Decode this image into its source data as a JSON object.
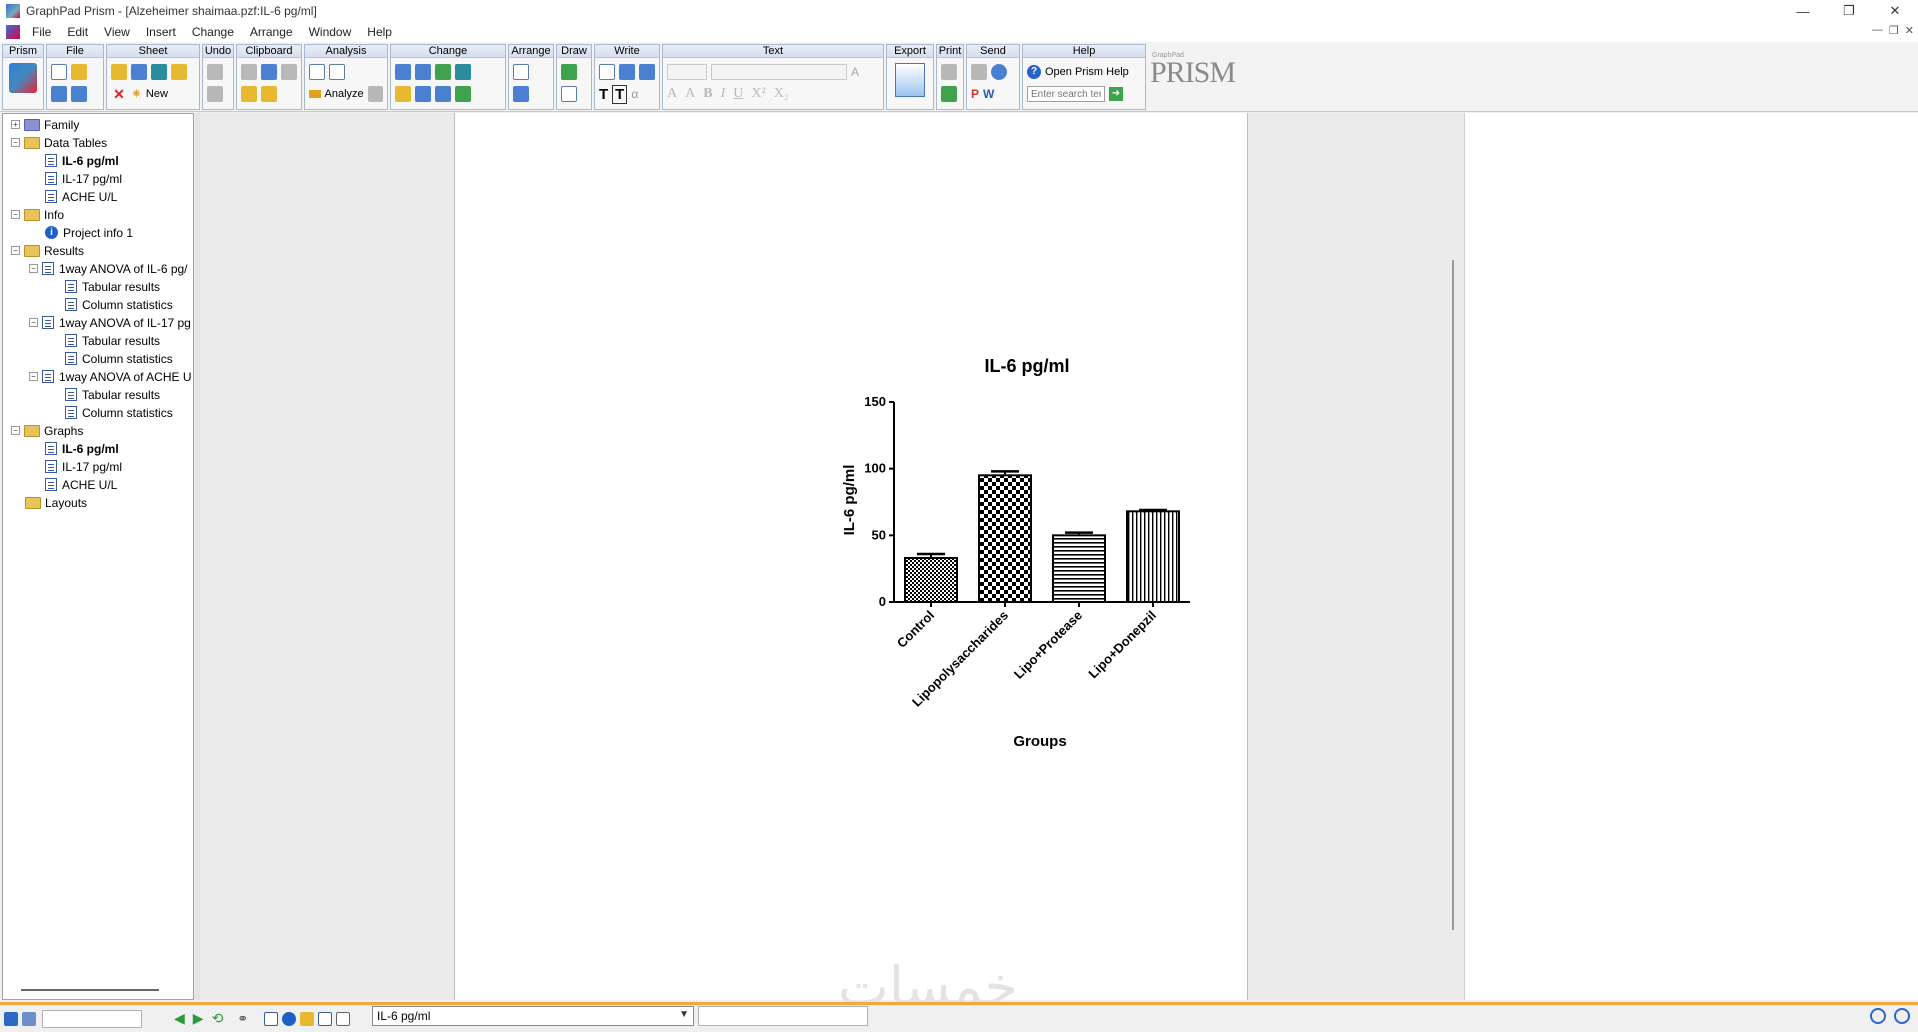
{
  "window": {
    "title": "GraphPad Prism - [Alzeheimer shaimaa.pzf:IL-6 pg/ml]"
  },
  "menu": [
    "File",
    "Edit",
    "View",
    "Insert",
    "Change",
    "Arrange",
    "Window",
    "Help"
  ],
  "ribbon": {
    "groups": [
      "Prism",
      "File",
      "Sheet",
      "Undo",
      "Clipboard",
      "Analysis",
      "Change",
      "Arrange",
      "Draw",
      "Write",
      "Text",
      "Export",
      "Print",
      "Send",
      "Help"
    ],
    "sheet_new_label": "New",
    "analyze_label": "Analyze",
    "help_button_label": "Open Prism Help",
    "search_placeholder": "Enter search terms",
    "logo_small": "GraphPad",
    "logo": "PRISM"
  },
  "navigator": {
    "family": "Family",
    "data_tables": "Data Tables",
    "data_items": [
      "IL-6 pg/ml",
      "IL-17 pg/ml",
      "ACHE U/L"
    ],
    "info": "Info",
    "info_items": [
      "Project info 1"
    ],
    "results": "Results",
    "result_groups": [
      {
        "label": "1way ANOVA of IL-6 pg/",
        "children": [
          "Tabular results",
          "Column statistics"
        ]
      },
      {
        "label": "1way ANOVA of IL-17 pg",
        "children": [
          "Tabular results",
          "Column statistics"
        ]
      },
      {
        "label": "1way ANOVA of ACHE U",
        "children": [
          "Tabular results",
          "Column statistics"
        ]
      }
    ],
    "graphs": "Graphs",
    "graph_items": [
      "IL-6 pg/ml",
      "IL-17 pg/ml",
      "ACHE U/L"
    ],
    "layouts": "Layouts"
  },
  "status": {
    "sheet_selector": "IL-6 pg/ml"
  },
  "watermark": "خمسات",
  "chart_data": {
    "type": "bar",
    "title": "IL-6 pg/ml",
    "xlabel": "Groups",
    "ylabel": "IL-6 pg/ml",
    "categories": [
      "Control",
      "Lipopolysaccharides",
      "Lipo+Protease",
      "Lipo+Donepzil"
    ],
    "values": [
      33,
      95,
      50,
      68
    ],
    "errors": [
      3,
      3,
      2,
      1
    ],
    "patterns": [
      "fine-check",
      "checker",
      "horizontal",
      "vertical"
    ],
    "ylim": [
      0,
      150
    ],
    "yticks": [
      0,
      50,
      100,
      150
    ],
    "grid": false
  }
}
